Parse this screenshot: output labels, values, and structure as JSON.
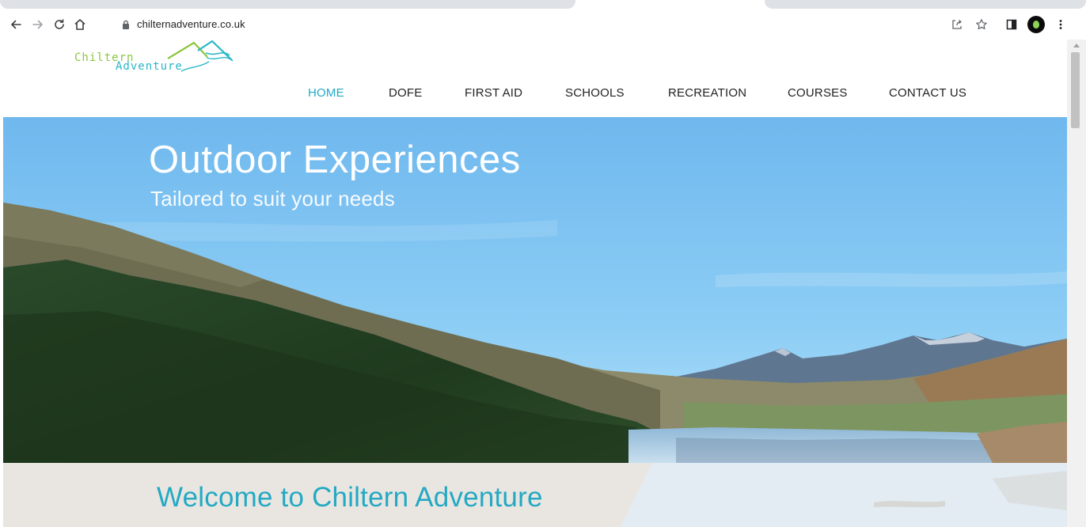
{
  "browser": {
    "url": "chilternadventure.co.uk"
  },
  "site": {
    "logo": {
      "line1": "Chiltern",
      "line2": "Adventure"
    },
    "nav": [
      {
        "label": "HOME",
        "active": true
      },
      {
        "label": "DOFE",
        "active": false
      },
      {
        "label": "FIRST AID",
        "active": false
      },
      {
        "label": "SCHOOLS",
        "active": false
      },
      {
        "label": "RECREATION",
        "active": false
      },
      {
        "label": "COURSES",
        "active": false
      },
      {
        "label": "CONTACT US",
        "active": false
      }
    ],
    "hero": {
      "title": "Outdoor Experiences",
      "subtitle": "Tailored to suit your needs"
    },
    "welcome": {
      "title": "Welcome to Chiltern Adventure"
    }
  },
  "colors": {
    "accent": "#23a9c4",
    "logo_green": "#8cc63f",
    "sky_top": "#6fb8ee",
    "sky_bottom": "#a9dcf8"
  },
  "icons": {
    "back": "arrow-left-icon",
    "forward": "arrow-right-icon",
    "reload": "reload-icon",
    "home": "home-icon",
    "lock": "lock-icon",
    "share": "share-icon",
    "bookmark": "star-icon",
    "side_panel": "side-panel-icon",
    "profile": "profile-avatar",
    "menu": "kebab-menu-icon"
  }
}
